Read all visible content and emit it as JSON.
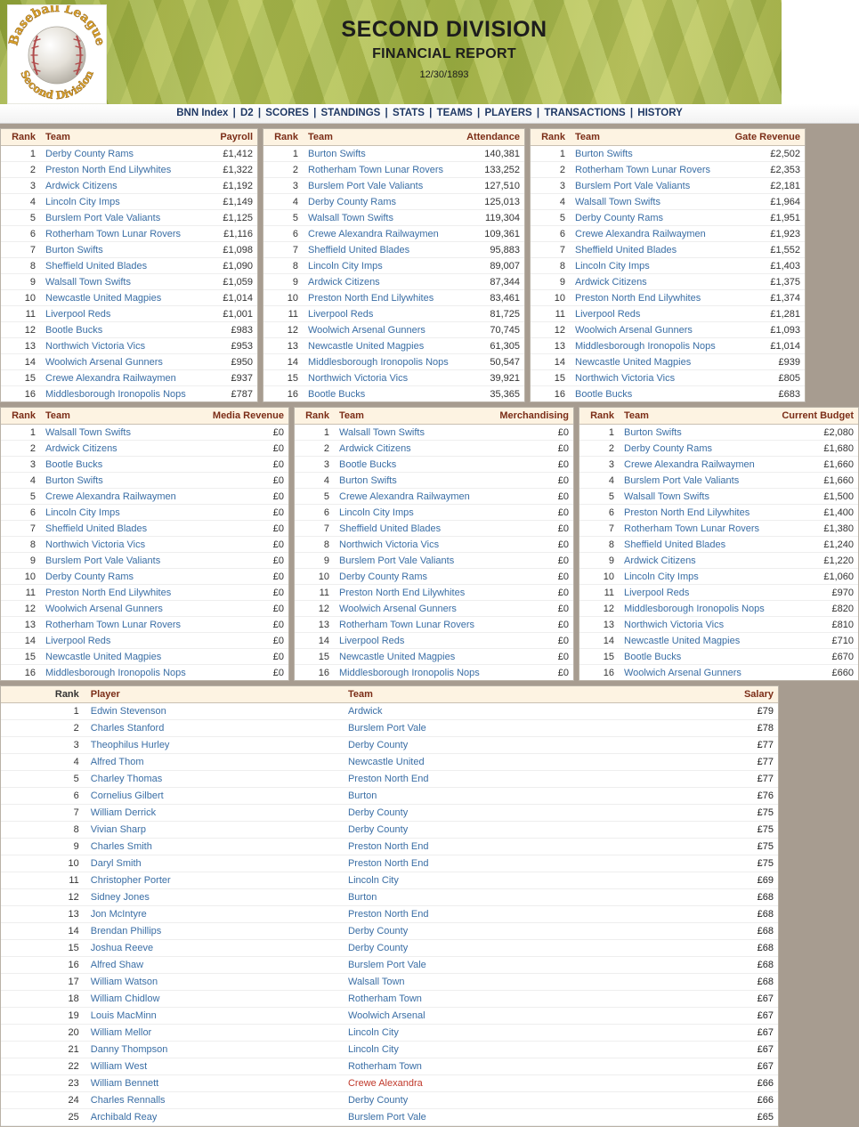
{
  "header": {
    "logo": {
      "top_text": "Baseball League",
      "bottom_text": "Second Division",
      "alt": "baseball-league-second-division-logo"
    },
    "title": "SECOND DIVISION",
    "subtitle": "FINANCIAL REPORT",
    "date": "12/30/1893"
  },
  "nav": {
    "separator": "|",
    "items": [
      "BNN Index",
      "D2",
      "SCORES",
      "STANDINGS",
      "STATS",
      "TEAMS",
      "PLAYERS",
      "TRANSACTIONS",
      "HISTORY"
    ]
  },
  "common": {
    "rank_header": "Rank",
    "team_header": "Team"
  },
  "tables": {
    "payroll": {
      "value_header": "Payroll",
      "rows": [
        {
          "rank": 1,
          "team": "Derby County Rams",
          "value": "£1,412"
        },
        {
          "rank": 2,
          "team": "Preston North End Lilywhites",
          "value": "£1,322"
        },
        {
          "rank": 3,
          "team": "Ardwick Citizens",
          "value": "£1,192"
        },
        {
          "rank": 4,
          "team": "Lincoln City Imps",
          "value": "£1,149"
        },
        {
          "rank": 5,
          "team": "Burslem Port Vale Valiants",
          "value": "£1,125"
        },
        {
          "rank": 6,
          "team": "Rotherham Town Lunar Rovers",
          "value": "£1,116"
        },
        {
          "rank": 7,
          "team": "Burton Swifts",
          "value": "£1,098"
        },
        {
          "rank": 8,
          "team": "Sheffield United Blades",
          "value": "£1,090"
        },
        {
          "rank": 9,
          "team": "Walsall Town Swifts",
          "value": "£1,059"
        },
        {
          "rank": 10,
          "team": "Newcastle United Magpies",
          "value": "£1,014"
        },
        {
          "rank": 11,
          "team": "Liverpool Reds",
          "value": "£1,001"
        },
        {
          "rank": 12,
          "team": "Bootle Bucks",
          "value": "£983"
        },
        {
          "rank": 13,
          "team": "Northwich Victoria Vics",
          "value": "£953"
        },
        {
          "rank": 14,
          "team": "Woolwich Arsenal Gunners",
          "value": "£950"
        },
        {
          "rank": 15,
          "team": "Crewe Alexandra Railwaymen",
          "value": "£937"
        },
        {
          "rank": 16,
          "team": "Middlesborough Ironopolis Nops",
          "value": "£787"
        }
      ]
    },
    "attendance": {
      "value_header": "Attendance",
      "rows": [
        {
          "rank": 1,
          "team": "Burton Swifts",
          "value": "140,381"
        },
        {
          "rank": 2,
          "team": "Rotherham Town Lunar Rovers",
          "value": "133,252"
        },
        {
          "rank": 3,
          "team": "Burslem Port Vale Valiants",
          "value": "127,510"
        },
        {
          "rank": 4,
          "team": "Derby County Rams",
          "value": "125,013"
        },
        {
          "rank": 5,
          "team": "Walsall Town Swifts",
          "value": "119,304"
        },
        {
          "rank": 6,
          "team": "Crewe Alexandra Railwaymen",
          "value": "109,361"
        },
        {
          "rank": 7,
          "team": "Sheffield United Blades",
          "value": "95,883"
        },
        {
          "rank": 8,
          "team": "Lincoln City Imps",
          "value": "89,007"
        },
        {
          "rank": 9,
          "team": "Ardwick Citizens",
          "value": "87,344"
        },
        {
          "rank": 10,
          "team": "Preston North End Lilywhites",
          "value": "83,461"
        },
        {
          "rank": 11,
          "team": "Liverpool Reds",
          "value": "81,725"
        },
        {
          "rank": 12,
          "team": "Woolwich Arsenal Gunners",
          "value": "70,745"
        },
        {
          "rank": 13,
          "team": "Newcastle United Magpies",
          "value": "61,305"
        },
        {
          "rank": 14,
          "team": "Middlesborough Ironopolis Nops",
          "value": "50,547"
        },
        {
          "rank": 15,
          "team": "Northwich Victoria Vics",
          "value": "39,921"
        },
        {
          "rank": 16,
          "team": "Bootle Bucks",
          "value": "35,365"
        }
      ]
    },
    "gate_revenue": {
      "value_header": "Gate Revenue",
      "rows": [
        {
          "rank": 1,
          "team": "Burton Swifts",
          "value": "£2,502"
        },
        {
          "rank": 2,
          "team": "Rotherham Town Lunar Rovers",
          "value": "£2,353"
        },
        {
          "rank": 3,
          "team": "Burslem Port Vale Valiants",
          "value": "£2,181"
        },
        {
          "rank": 4,
          "team": "Walsall Town Swifts",
          "value": "£1,964"
        },
        {
          "rank": 5,
          "team": "Derby County Rams",
          "value": "£1,951"
        },
        {
          "rank": 6,
          "team": "Crewe Alexandra Railwaymen",
          "value": "£1,923"
        },
        {
          "rank": 7,
          "team": "Sheffield United Blades",
          "value": "£1,552"
        },
        {
          "rank": 8,
          "team": "Lincoln City Imps",
          "value": "£1,403"
        },
        {
          "rank": 9,
          "team": "Ardwick Citizens",
          "value": "£1,375"
        },
        {
          "rank": 10,
          "team": "Preston North End Lilywhites",
          "value": "£1,374"
        },
        {
          "rank": 11,
          "team": "Liverpool Reds",
          "value": "£1,281"
        },
        {
          "rank": 12,
          "team": "Woolwich Arsenal Gunners",
          "value": "£1,093"
        },
        {
          "rank": 13,
          "team": "Middlesborough Ironopolis Nops",
          "value": "£1,014"
        },
        {
          "rank": 14,
          "team": "Newcastle United Magpies",
          "value": "£939"
        },
        {
          "rank": 15,
          "team": "Northwich Victoria Vics",
          "value": "£805"
        },
        {
          "rank": 16,
          "team": "Bootle Bucks",
          "value": "£683"
        }
      ]
    },
    "media_revenue": {
      "value_header": "Media Revenue",
      "rows": [
        {
          "rank": 1,
          "team": "Walsall Town Swifts",
          "value": "£0"
        },
        {
          "rank": 2,
          "team": "Ardwick Citizens",
          "value": "£0"
        },
        {
          "rank": 3,
          "team": "Bootle Bucks",
          "value": "£0"
        },
        {
          "rank": 4,
          "team": "Burton Swifts",
          "value": "£0"
        },
        {
          "rank": 5,
          "team": "Crewe Alexandra Railwaymen",
          "value": "£0"
        },
        {
          "rank": 6,
          "team": "Lincoln City Imps",
          "value": "£0"
        },
        {
          "rank": 7,
          "team": "Sheffield United Blades",
          "value": "£0"
        },
        {
          "rank": 8,
          "team": "Northwich Victoria Vics",
          "value": "£0"
        },
        {
          "rank": 9,
          "team": "Burslem Port Vale Valiants",
          "value": "£0"
        },
        {
          "rank": 10,
          "team": "Derby County Rams",
          "value": "£0"
        },
        {
          "rank": 11,
          "team": "Preston North End Lilywhites",
          "value": "£0"
        },
        {
          "rank": 12,
          "team": "Woolwich Arsenal Gunners",
          "value": "£0"
        },
        {
          "rank": 13,
          "team": "Rotherham Town Lunar Rovers",
          "value": "£0"
        },
        {
          "rank": 14,
          "team": "Liverpool Reds",
          "value": "£0"
        },
        {
          "rank": 15,
          "team": "Newcastle United Magpies",
          "value": "£0"
        },
        {
          "rank": 16,
          "team": "Middlesborough Ironopolis Nops",
          "value": "£0"
        }
      ]
    },
    "merchandising": {
      "value_header": "Merchandising",
      "rows": [
        {
          "rank": 1,
          "team": "Walsall Town Swifts",
          "value": "£0"
        },
        {
          "rank": 2,
          "team": "Ardwick Citizens",
          "value": "£0"
        },
        {
          "rank": 3,
          "team": "Bootle Bucks",
          "value": "£0"
        },
        {
          "rank": 4,
          "team": "Burton Swifts",
          "value": "£0"
        },
        {
          "rank": 5,
          "team": "Crewe Alexandra Railwaymen",
          "value": "£0"
        },
        {
          "rank": 6,
          "team": "Lincoln City Imps",
          "value": "£0"
        },
        {
          "rank": 7,
          "team": "Sheffield United Blades",
          "value": "£0"
        },
        {
          "rank": 8,
          "team": "Northwich Victoria Vics",
          "value": "£0"
        },
        {
          "rank": 9,
          "team": "Burslem Port Vale Valiants",
          "value": "£0"
        },
        {
          "rank": 10,
          "team": "Derby County Rams",
          "value": "£0"
        },
        {
          "rank": 11,
          "team": "Preston North End Lilywhites",
          "value": "£0"
        },
        {
          "rank": 12,
          "team": "Woolwich Arsenal Gunners",
          "value": "£0"
        },
        {
          "rank": 13,
          "team": "Rotherham Town Lunar Rovers",
          "value": "£0"
        },
        {
          "rank": 14,
          "team": "Liverpool Reds",
          "value": "£0"
        },
        {
          "rank": 15,
          "team": "Newcastle United Magpies",
          "value": "£0"
        },
        {
          "rank": 16,
          "team": "Middlesborough Ironopolis Nops",
          "value": "£0"
        }
      ]
    },
    "current_budget": {
      "value_header": "Current Budget",
      "rows": [
        {
          "rank": 1,
          "team": "Burton Swifts",
          "value": "£2,080"
        },
        {
          "rank": 2,
          "team": "Derby County Rams",
          "value": "£1,680"
        },
        {
          "rank": 3,
          "team": "Crewe Alexandra Railwaymen",
          "value": "£1,660"
        },
        {
          "rank": 4,
          "team": "Burslem Port Vale Valiants",
          "value": "£1,660"
        },
        {
          "rank": 5,
          "team": "Walsall Town Swifts",
          "value": "£1,500"
        },
        {
          "rank": 6,
          "team": "Preston North End Lilywhites",
          "value": "£1,400"
        },
        {
          "rank": 7,
          "team": "Rotherham Town Lunar Rovers",
          "value": "£1,380"
        },
        {
          "rank": 8,
          "team": "Sheffield United Blades",
          "value": "£1,240"
        },
        {
          "rank": 9,
          "team": "Ardwick Citizens",
          "value": "£1,220"
        },
        {
          "rank": 10,
          "team": "Lincoln City Imps",
          "value": "£1,060"
        },
        {
          "rank": 11,
          "team": "Liverpool Reds",
          "value": "£970"
        },
        {
          "rank": 12,
          "team": "Middlesborough Ironopolis Nops",
          "value": "£820"
        },
        {
          "rank": 13,
          "team": "Northwich Victoria Vics",
          "value": "£810"
        },
        {
          "rank": 14,
          "team": "Newcastle United Magpies",
          "value": "£710"
        },
        {
          "rank": 15,
          "team": "Bootle Bucks",
          "value": "£670"
        },
        {
          "rank": 16,
          "team": "Woolwich Arsenal Gunners",
          "value": "£660"
        }
      ]
    }
  },
  "players": {
    "headers": {
      "rank": "Rank",
      "player": "Player",
      "team": "Team",
      "salary": "Salary"
    },
    "rows": [
      {
        "rank": 1,
        "player": "Edwin Stevenson",
        "team": "Ardwick",
        "salary": "£79",
        "highlight": false
      },
      {
        "rank": 2,
        "player": "Charles Stanford",
        "team": "Burslem Port Vale",
        "salary": "£78",
        "highlight": false
      },
      {
        "rank": 3,
        "player": "Theophilus Hurley",
        "team": "Derby County",
        "salary": "£77",
        "highlight": false
      },
      {
        "rank": 4,
        "player": "Alfred Thom",
        "team": "Newcastle United",
        "salary": "£77",
        "highlight": false
      },
      {
        "rank": 5,
        "player": "Charley Thomas",
        "team": "Preston North End",
        "salary": "£77",
        "highlight": false
      },
      {
        "rank": 6,
        "player": "Cornelius Gilbert",
        "team": "Burton",
        "salary": "£76",
        "highlight": false
      },
      {
        "rank": 7,
        "player": "William Derrick",
        "team": "Derby County",
        "salary": "£75",
        "highlight": false
      },
      {
        "rank": 8,
        "player": "Vivian Sharp",
        "team": "Derby County",
        "salary": "£75",
        "highlight": false
      },
      {
        "rank": 9,
        "player": "Charles Smith",
        "team": "Preston North End",
        "salary": "£75",
        "highlight": false
      },
      {
        "rank": 10,
        "player": "Daryl Smith",
        "team": "Preston North End",
        "salary": "£75",
        "highlight": false
      },
      {
        "rank": 11,
        "player": "Christopher Porter",
        "team": "Lincoln City",
        "salary": "£69",
        "highlight": false
      },
      {
        "rank": 12,
        "player": "Sidney Jones",
        "team": "Burton",
        "salary": "£68",
        "highlight": false
      },
      {
        "rank": 13,
        "player": "Jon McIntyre",
        "team": "Preston North End",
        "salary": "£68",
        "highlight": false
      },
      {
        "rank": 14,
        "player": "Brendan Phillips",
        "team": "Derby County",
        "salary": "£68",
        "highlight": false
      },
      {
        "rank": 15,
        "player": "Joshua Reeve",
        "team": "Derby County",
        "salary": "£68",
        "highlight": false
      },
      {
        "rank": 16,
        "player": "Alfred Shaw",
        "team": "Burslem Port Vale",
        "salary": "£68",
        "highlight": false
      },
      {
        "rank": 17,
        "player": "William Watson",
        "team": "Walsall Town",
        "salary": "£68",
        "highlight": false
      },
      {
        "rank": 18,
        "player": "William Chidlow",
        "team": "Rotherham Town",
        "salary": "£67",
        "highlight": false
      },
      {
        "rank": 19,
        "player": "Louis MacMinn",
        "team": "Woolwich Arsenal",
        "salary": "£67",
        "highlight": false
      },
      {
        "rank": 20,
        "player": "William Mellor",
        "team": "Lincoln City",
        "salary": "£67",
        "highlight": false
      },
      {
        "rank": 21,
        "player": "Danny Thompson",
        "team": "Lincoln City",
        "salary": "£67",
        "highlight": false
      },
      {
        "rank": 22,
        "player": "William West",
        "team": "Rotherham Town",
        "salary": "£67",
        "highlight": false
      },
      {
        "rank": 23,
        "player": "William Bennett",
        "team": "Crewe Alexandra",
        "salary": "£66",
        "highlight": true
      },
      {
        "rank": 24,
        "player": "Charles Rennalls",
        "team": "Derby County",
        "salary": "£66",
        "highlight": false
      },
      {
        "rank": 25,
        "player": "Archibald Reay",
        "team": "Burslem Port Vale",
        "salary": "£65",
        "highlight": false
      }
    ]
  },
  "colors": {
    "header_text": "#7b2d17",
    "header_bg": "#fdf3e2",
    "link": "#3a6ea5",
    "link_highlight": "#c0392b",
    "page_bg": "#a79c90",
    "nav_text": "#1f3864"
  }
}
